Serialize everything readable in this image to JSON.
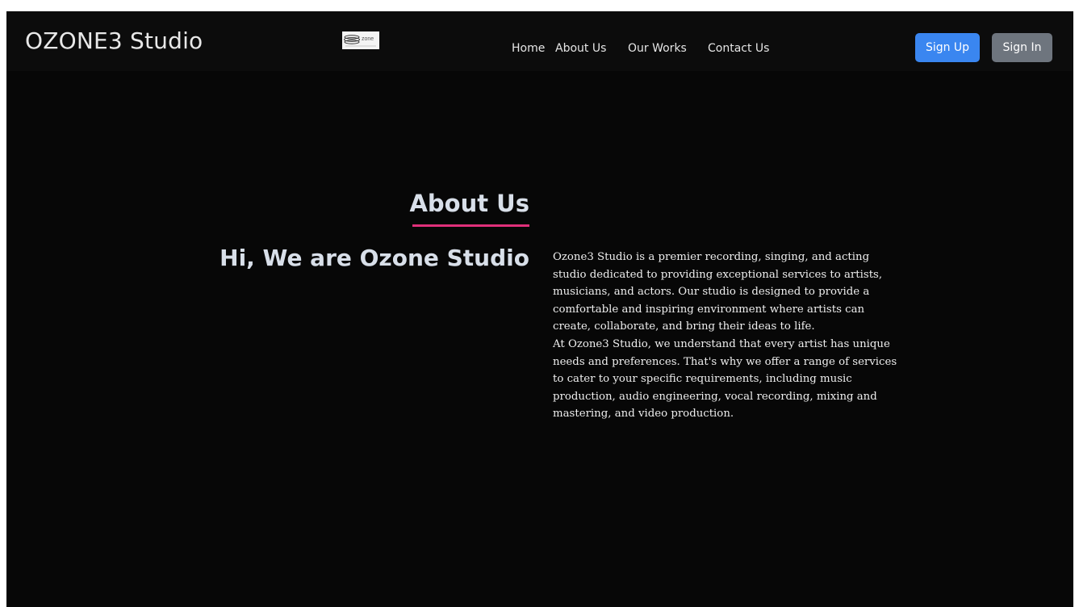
{
  "navbar": {
    "brand": "OZONE3 Studio",
    "logo_text": "zone",
    "links": [
      "Home",
      "About Us",
      "Our Works",
      "Contact Us"
    ],
    "signup_label": "Sign Up",
    "signin_label": "Sign In"
  },
  "about": {
    "heading": "About Us",
    "subheading": "Hi, We are Ozone Studio",
    "paragraphs": [
      "Ozone3 Studio is a premier recording, singing, and acting studio dedicated to providing exceptional services to artists, musicians, and actors. Our studio is designed to provide a comfortable and inspiring environment where artists can create, collaborate, and bring their ideas to life.",
      "At Ozone3 Studio, we understand that every artist has unique needs and preferences. That's why we offer a range of services to cater to your specific requirements, including music production, audio engineering, vocal recording, mixing and mastering, and video production."
    ]
  },
  "colors": {
    "background": "#070707",
    "accent_underline": "#e0307a",
    "signup_button": "#3a86f0",
    "signin_button": "#6e757e"
  }
}
